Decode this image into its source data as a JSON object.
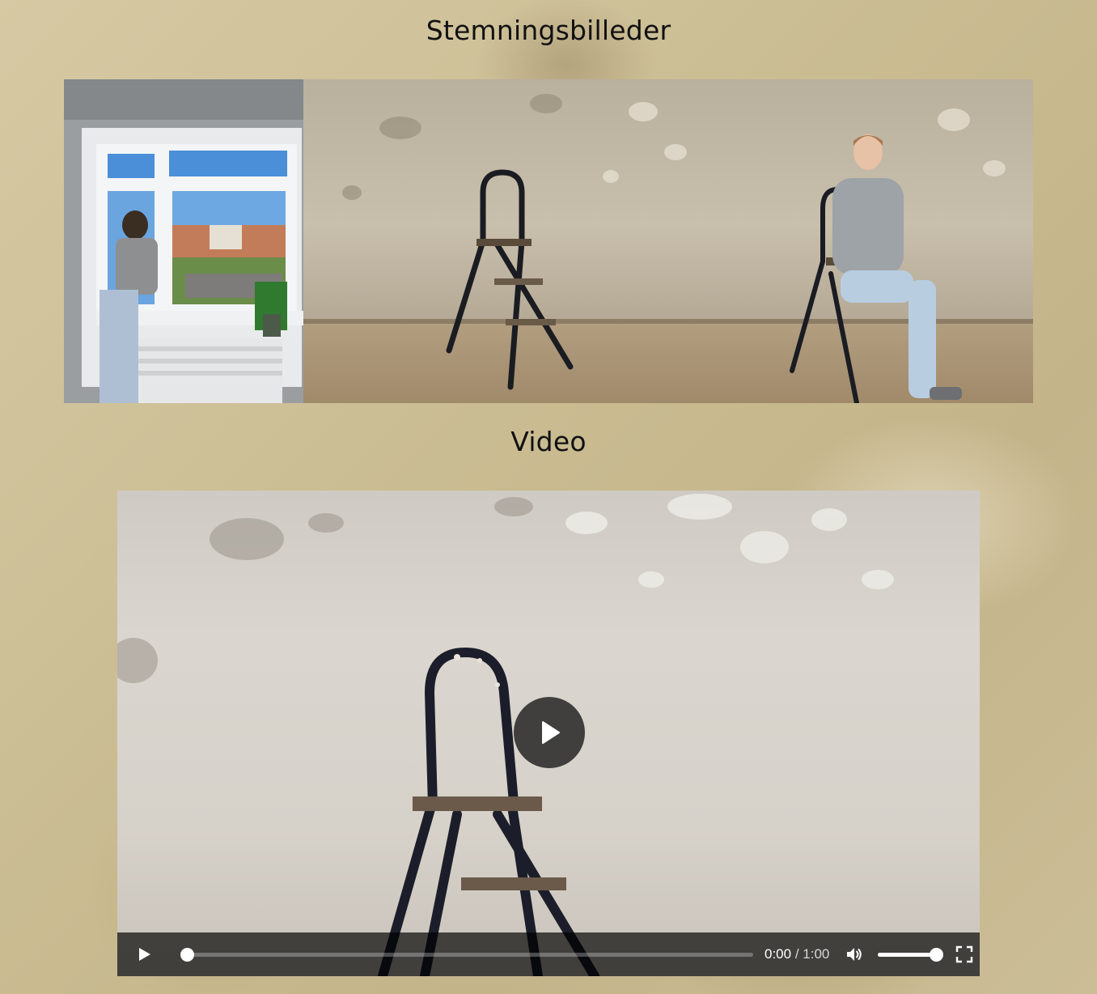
{
  "page": {
    "mood_heading": "Stemningsbilleder",
    "video_heading": "Video"
  },
  "gallery": {
    "images": [
      {
        "name": "woman-cleaning-window-photo"
      },
      {
        "name": "stepladder-photo"
      },
      {
        "name": "woman-on-stepladder-photo"
      }
    ]
  },
  "video": {
    "current_time": "0:00",
    "separator": "/",
    "duration": "1:00",
    "progress_fraction": 0.0,
    "volume_fraction": 1.0,
    "icons": {
      "big_play": "play-icon",
      "play": "play-icon",
      "volume": "volume-icon",
      "fullscreen": "fullscreen-icon"
    }
  },
  "colors": {
    "background": "#cdbf98",
    "heading_text": "#111111",
    "controls_bar": "#1a1a1a",
    "controls_text": "#ffffff"
  }
}
